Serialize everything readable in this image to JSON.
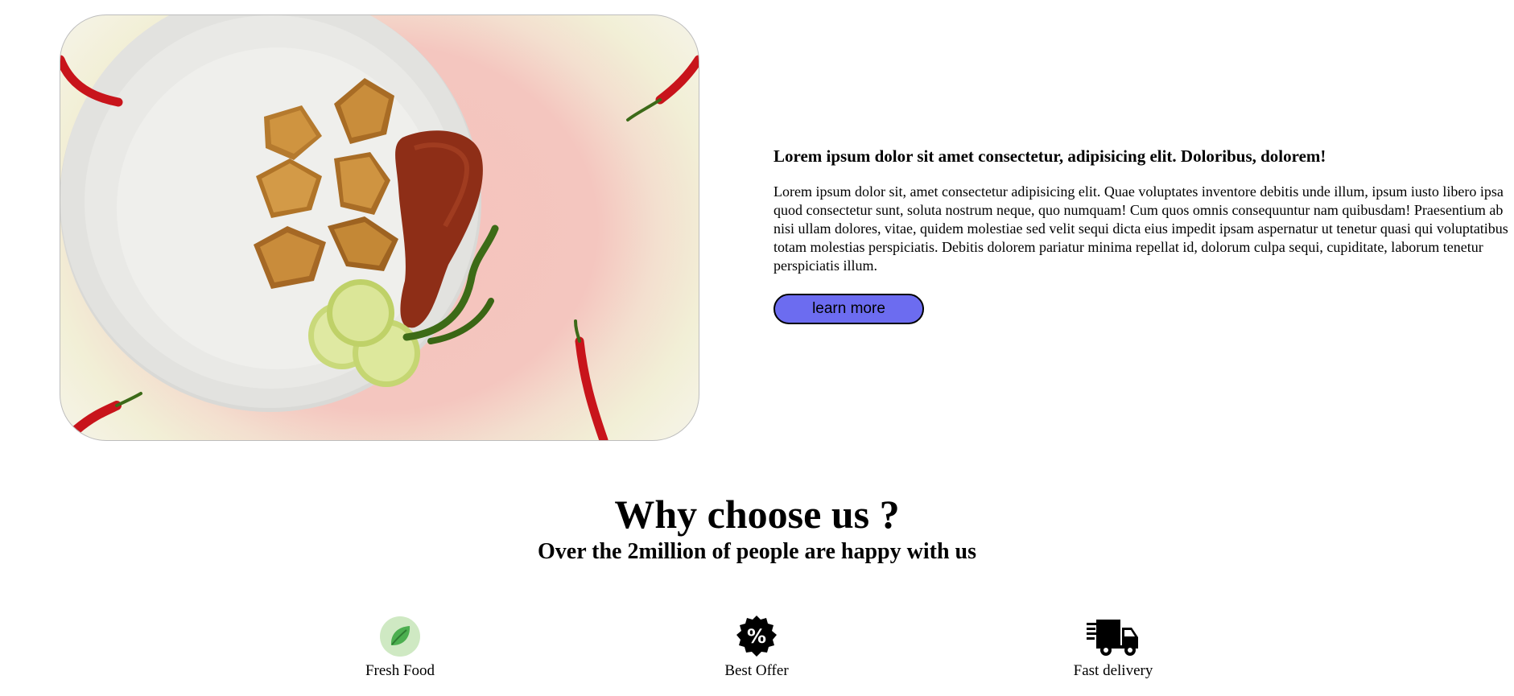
{
  "hero": {
    "image_name": "samosa-plate-with-chilli-and-lime"
  },
  "intro": {
    "heading": "Lorem ipsum dolor sit amet consectetur, adipisicing elit. Doloribus, dolorem!",
    "body": "Lorem ipsum dolor sit, amet consectetur adipisicing elit. Quae voluptates inventore debitis unde illum, ipsum iusto libero ipsa quod consectetur sunt, soluta nostrum neque, quo numquam! Cum quos omnis consequuntur nam quibusdam! Praesentium ab nisi ullam dolores, vitae, quidem molestiae sed velit sequi dicta eius impedit ipsam aspernatur ut tenetur quasi qui voluptatibus totam molestias perspiciatis. Debitis dolorem pariatur minima repellat id, dolorum culpa sequi, cupiditate, laborum tenetur perspiciatis illum.",
    "button_label": "learn more",
    "button_color": "#6c6cf0"
  },
  "why": {
    "title": "Why choose us ?",
    "subtitle": "Over the 2million of people are happy with us"
  },
  "features": [
    {
      "icon": "leaf-icon",
      "label": "Fresh Food",
      "color": "#4caf50"
    },
    {
      "icon": "discount-badge-icon",
      "label": "Best Offer",
      "color": "#000000"
    },
    {
      "icon": "delivery-truck-icon",
      "label": "Fast delivery",
      "color": "#000000"
    }
  ]
}
